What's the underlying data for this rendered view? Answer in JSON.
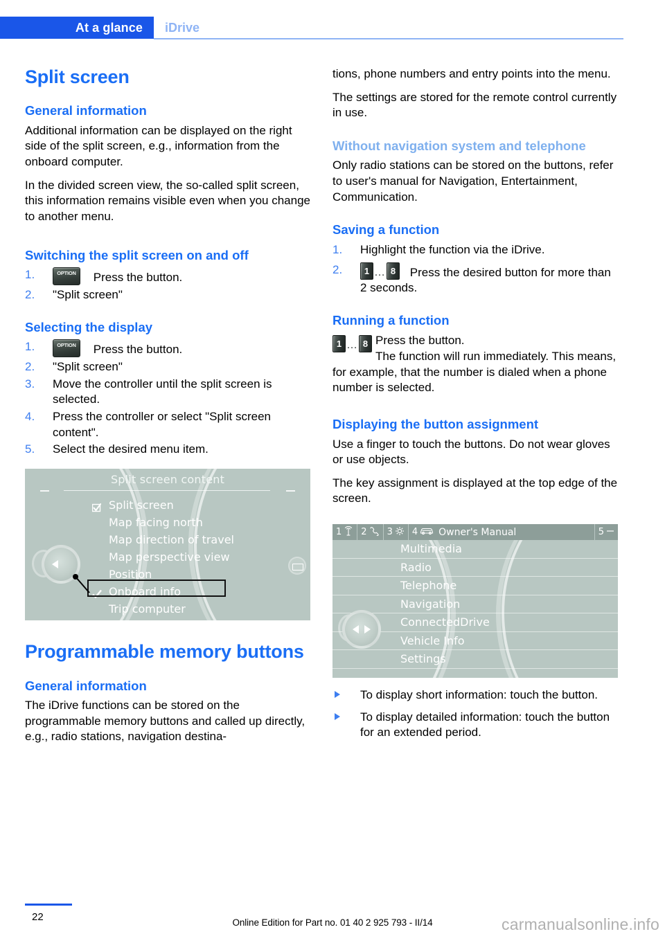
{
  "header": {
    "tab_active": "At a glance",
    "tab_inactive": "iDrive",
    "accent_color": "#1a56e8",
    "inactive_color": "#8fb4f5"
  },
  "left_column": {
    "chapter_title": "Split screen",
    "general_information_heading": "General information",
    "general_p1": "Additional information can be displayed on the right side of the split screen, e.g., information from the onboard computer.",
    "general_p2": "In the divided screen view, the so-called split screen, this information remains visible even when you change to another menu.",
    "switching_heading": "Switching the split screen on and off",
    "switching_steps": [
      {
        "num": "1.",
        "icon": "option-button-icon",
        "text": "Press the button."
      },
      {
        "num": "2.",
        "icon": null,
        "text": "\"Split screen\""
      }
    ],
    "selecting_heading": "Selecting the display",
    "selecting_steps": [
      {
        "num": "1.",
        "icon": "option-button-icon",
        "text": "Press the button."
      },
      {
        "num": "2.",
        "icon": null,
        "text": "\"Split screen\""
      },
      {
        "num": "3.",
        "icon": null,
        "text": "Move the controller until the split screen is selected."
      },
      {
        "num": "4.",
        "icon": null,
        "text": "Press the controller or select \"Split screen content\"."
      },
      {
        "num": "5.",
        "icon": null,
        "text": "Select the desired menu item."
      }
    ],
    "memory_chapter_title": "Programmable memory buttons",
    "memory_general_heading": "General information",
    "memory_p1": "The iDrive functions can be stored on the programmable memory buttons and called up directly, e.g., radio stations, navigation destina-"
  },
  "right_column": {
    "continuation_p1": "tions, phone numbers and entry points into the menu.",
    "continuation_p2": "The settings are stored for the remote control currently in use.",
    "without_nav_heading": "Without navigation system and telephone",
    "without_nav_p1": "Only radio stations can be stored on the buttons, refer to user's manual for Navigation, Entertainment, Communication.",
    "saving_heading": "Saving a function",
    "saving_steps": [
      {
        "num": "1.",
        "icon": null,
        "text": "Highlight the function via the iDrive."
      },
      {
        "num": "2.",
        "icon": "memory-buttons-1-8-icon",
        "text": "Press the desired button for more than 2 seconds."
      }
    ],
    "running_heading": "Running a function",
    "running_icon": "memory-buttons-1-8-icon",
    "running_line1": "Press the button.",
    "running_line2": "The function will run immediately. This means, for example, that the number is dialed when a phone number is selected.",
    "displaying_heading": "Displaying the button assignment",
    "displaying_p1": "Use a finger to touch the buttons. Do not wear gloves or use objects.",
    "displaying_p2": "The key assignment is displayed at the top edge of the screen.",
    "bullets": [
      "To display short information: touch the button.",
      "To display detailed information: touch the button for an extended period."
    ]
  },
  "memory_button_icon": {
    "first": "1",
    "ellipsis": "…",
    "last": "8"
  },
  "option_button_icon": {
    "label": "OPTION"
  },
  "idrive_screen_1": {
    "title": "Split screen content",
    "items": [
      {
        "label": "Split screen",
        "mark": "checkbox-checked-icon",
        "highlighted": false
      },
      {
        "label": "Map facing north",
        "mark": null,
        "highlighted": false
      },
      {
        "label": "Map direction of travel",
        "mark": null,
        "highlighted": false
      },
      {
        "label": "Map perspective view",
        "mark": null,
        "highlighted": false
      },
      {
        "label": "Position",
        "mark": null,
        "highlighted": false
      },
      {
        "label": "Onboard info",
        "mark": "checkmark-icon",
        "highlighted": true
      },
      {
        "label": "Trip computer",
        "mark": null,
        "highlighted": false
      }
    ],
    "background_color": "#b8c7c2"
  },
  "idrive_screen_2": {
    "top_bar": [
      {
        "num": "1",
        "icon": "radio-antenna-icon",
        "label": ""
      },
      {
        "num": "2",
        "icon": "telephone-icon",
        "label": ""
      },
      {
        "num": "3",
        "icon": "gear-icon",
        "label": ""
      },
      {
        "num": "4",
        "icon": "car-icon",
        "label": "Owner's Manual"
      },
      {
        "num": "5",
        "icon": "dash-icon",
        "label": ""
      }
    ],
    "menu_items": [
      "Multimedia",
      "Radio",
      "Telephone",
      "Navigation",
      "ConnectedDrive",
      "Vehicle Info",
      "Settings"
    ],
    "background_color": "#b8c7c2"
  },
  "footer": {
    "page_number": "22",
    "edition_text": "Online Edition for Part no. 01 40 2 925 793 - II/14",
    "watermark": "carmanualsonline.info"
  }
}
